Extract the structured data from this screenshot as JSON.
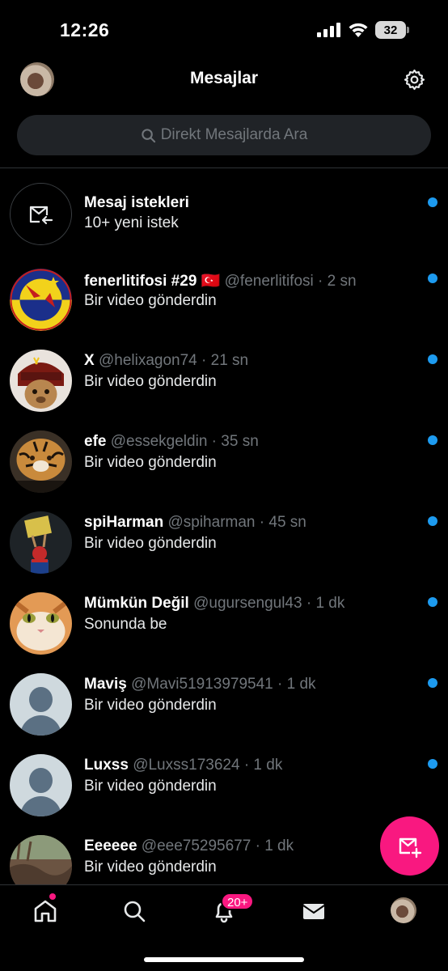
{
  "status_bar": {
    "time": "12:26",
    "battery": "32"
  },
  "header": {
    "title": "Mesajlar"
  },
  "search": {
    "placeholder": "Direkt Mesajlarda Ara"
  },
  "requests": {
    "title": "Mesaj istekleri",
    "subtitle": "10+ yeni istek"
  },
  "conversations": [
    {
      "name": "fenerlitifosi #29",
      "flag": "🇹🇷",
      "handle": "@fenerlitifosi",
      "time": "· 2 sn",
      "preview": "Bir video gönderdin"
    },
    {
      "name": "X",
      "handle": "@helixagon74",
      "time": "· 21 sn",
      "preview": "Bir video gönderdin"
    },
    {
      "name": "efe",
      "handle": "@essekgeldin",
      "time": "· 35 sn",
      "preview": "Bir video gönderdin"
    },
    {
      "name": "spiHarman",
      "handle": "@spiharman",
      "time": "· 45 sn",
      "preview": "Bir video gönderdin"
    },
    {
      "name": "Mümkün Değil",
      "handle": "@ugursengul43",
      "time": "· 1 dk",
      "preview": "Sonunda be"
    },
    {
      "name": "Maviş",
      "handle": "@Mavi51913979541",
      "time": "· 1 dk",
      "preview": "Bir video gönderdin"
    },
    {
      "name": "Luxss",
      "handle": "@Luxss173624",
      "time": "· 1 dk",
      "preview": "Bir video gönderdin"
    },
    {
      "name": "Eeeeee",
      "handle": "@eee75295677",
      "time": "· 1 dk",
      "preview": "Bir video gönderdin"
    }
  ],
  "tabbar": {
    "notif_badge": "20+"
  },
  "colors": {
    "accent": "#1d9bf0",
    "fab": "#f91880",
    "background": "#000000",
    "muted": "#71767b"
  }
}
